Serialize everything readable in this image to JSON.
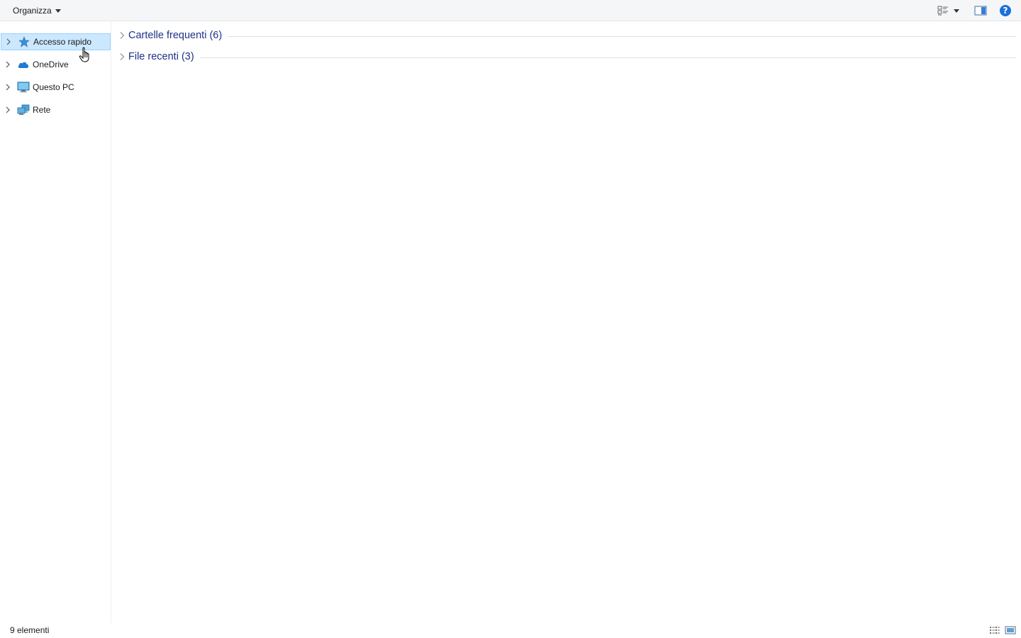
{
  "toolbar": {
    "organize_label": "Organizza",
    "icons": [
      "change-view-icon",
      "chevron-down-icon",
      "preview-pane-icon",
      "help-icon"
    ]
  },
  "nav": {
    "items": [
      {
        "label": "Accesso rapido",
        "icon": "star-icon",
        "selected": true
      },
      {
        "label": "OneDrive",
        "icon": "cloud-icon",
        "selected": false
      },
      {
        "label": "Questo PC",
        "icon": "computer-icon",
        "selected": false
      },
      {
        "label": "Rete",
        "icon": "network-icon",
        "selected": false
      }
    ]
  },
  "content": {
    "groups": [
      {
        "label": "Cartelle frequenti (6)",
        "expanded": false
      },
      {
        "label": "File recenti (3)",
        "expanded": false
      }
    ]
  },
  "status": {
    "item_count": "9 elementi",
    "icons": [
      "details-view-icon",
      "large-icons-view-icon"
    ]
  },
  "colors": {
    "selection_bg": "#cce8ff",
    "selection_border": "#99d1ff",
    "group_header": "#1e3287",
    "help_blue": "#1a6fd8"
  }
}
